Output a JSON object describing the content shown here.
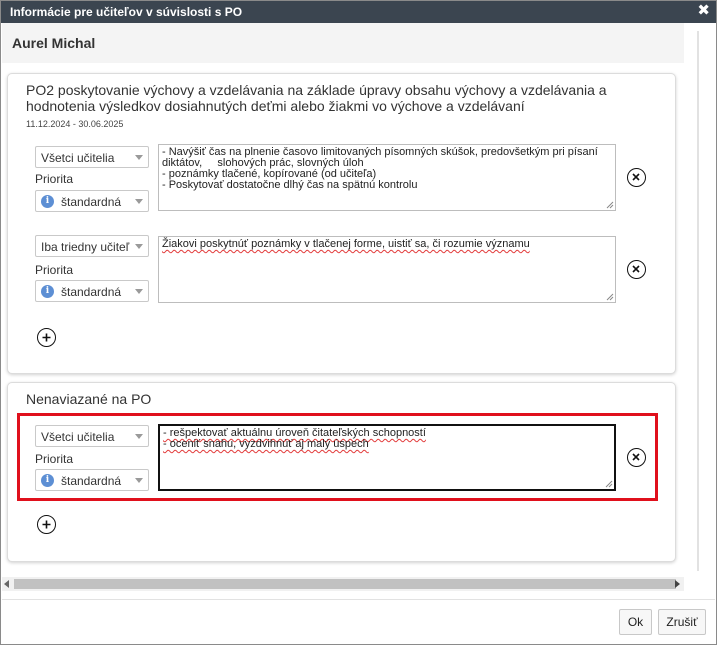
{
  "dialog": {
    "title": "Informácie pre učiteľov v súvislosti s PO",
    "close_glyph": "✖"
  },
  "person": {
    "name": "Aurel Michal"
  },
  "panel_po": {
    "title": "PO2 poskytovanie výchovy a vzdelávania na základe úpravy obsahu výchovy a vzdelávania a hodnotenia výsledkov dosiahnutých deťmi alebo žiakmi vo výchove a vzdelávaní",
    "dates": "11.12.2024 - 30.06.2025",
    "recommendations": [
      {
        "audience": "Všetci učitelia",
        "priority_label": "Priorita",
        "priority": "štandardná",
        "lines": [
          "- Navýšiť čas na plnenie časovo limitovaných písomných skúšok, predovšetkým pri písaní",
          "diktátov,     slohových prác, slovných úloh",
          "- poznámky tlačené, kopírované (od učiteľa)",
          "- Poskytovať dostatočne dlhý čas na spätnú kontrolu"
        ]
      },
      {
        "audience": "Iba triedny učiteľ",
        "priority_label": "Priorita",
        "priority": "štandardná",
        "lines": [
          "Žiakovi poskytnúť poznámky v tlačenej forme, uistiť sa, či rozumie významu"
        ]
      }
    ]
  },
  "panel_unlinked": {
    "title": "Nenaviazané na PO",
    "recommendations": [
      {
        "audience": "Všetci učitelia",
        "priority_label": "Priorita",
        "priority": "štandardná",
        "lines": [
          "- rešpektovať aktuálnu úroveň čitateľských schopností",
          "- oceniť snahu, vyzdvihnúť aj malý úspech"
        ]
      }
    ]
  },
  "buttons": {
    "ok": "Ok",
    "cancel": "Zrušiť"
  },
  "icons": {
    "close": "close-icon",
    "remove": "remove-circle-icon",
    "add": "add-circle-icon",
    "info": "info-icon",
    "info_glyph": "i"
  },
  "colors": {
    "titlebar": "#3b4550",
    "highlight": "#e0101c",
    "info_badge": "#5d8fd4"
  }
}
